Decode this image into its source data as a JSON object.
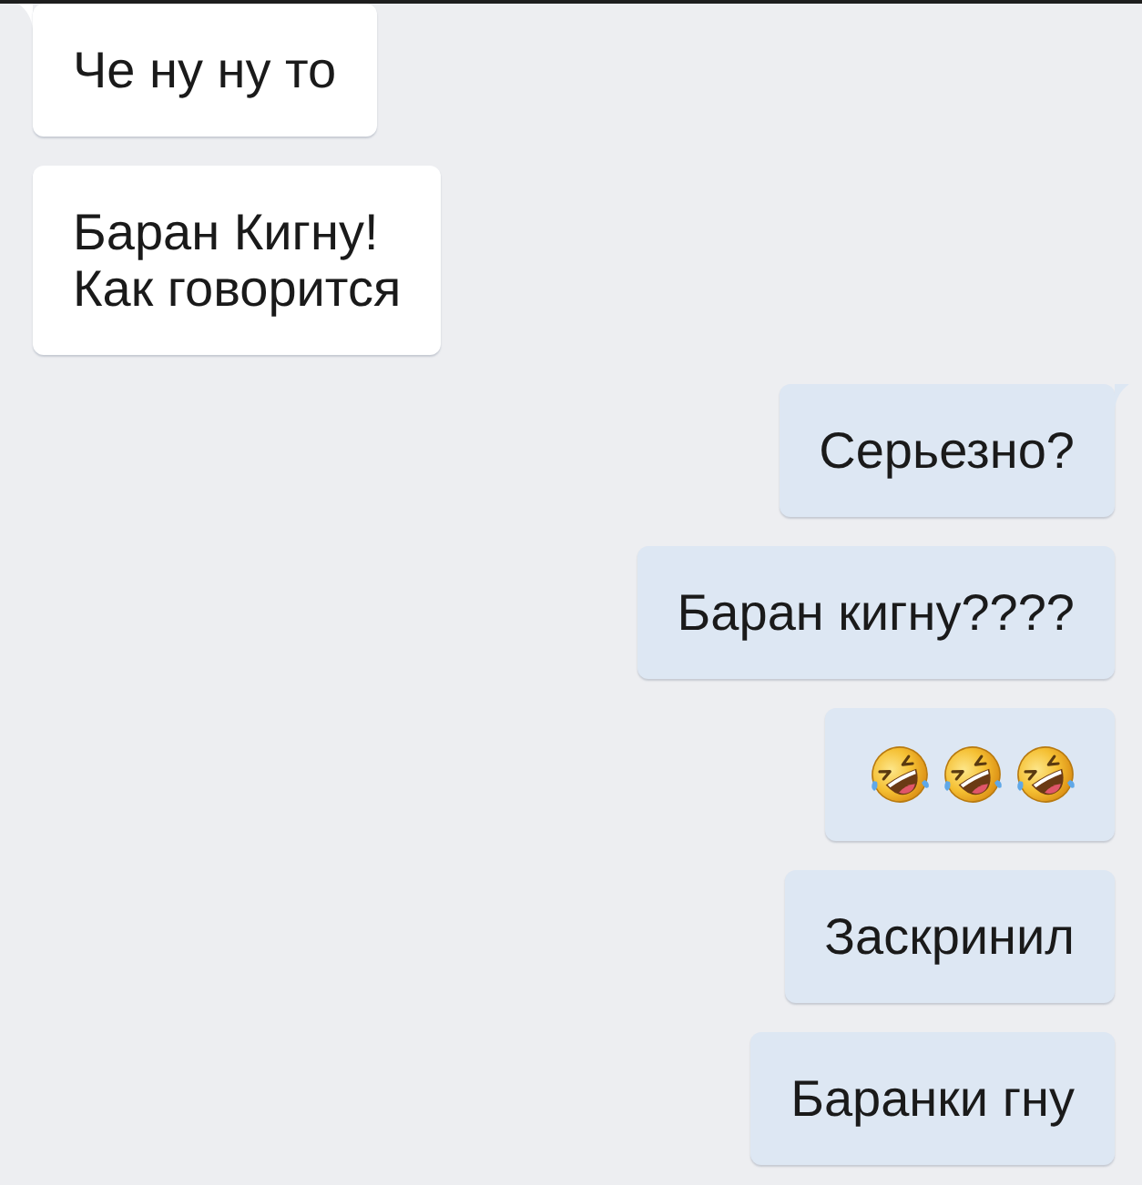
{
  "chat": {
    "messages": [
      {
        "outgoing": false,
        "tail": true,
        "kind": "text",
        "text": "Че ну ну то"
      },
      {
        "outgoing": false,
        "tail": false,
        "kind": "text",
        "text": "Баран Кигну!\nКак говорится"
      },
      {
        "outgoing": true,
        "tail": true,
        "kind": "text",
        "text": "Серьезно?"
      },
      {
        "outgoing": true,
        "tail": false,
        "kind": "text",
        "text": "Баран кигну????"
      },
      {
        "outgoing": true,
        "tail": false,
        "kind": "emoji",
        "emojis": [
          {
            "kind": "rolling-laughing"
          },
          {
            "kind": "rolling-laughing"
          },
          {
            "kind": "rolling-laughing"
          }
        ]
      },
      {
        "outgoing": true,
        "tail": false,
        "kind": "text",
        "text": "Заскринил"
      },
      {
        "outgoing": true,
        "tail": false,
        "kind": "text",
        "text": "Баранки гну"
      }
    ]
  }
}
